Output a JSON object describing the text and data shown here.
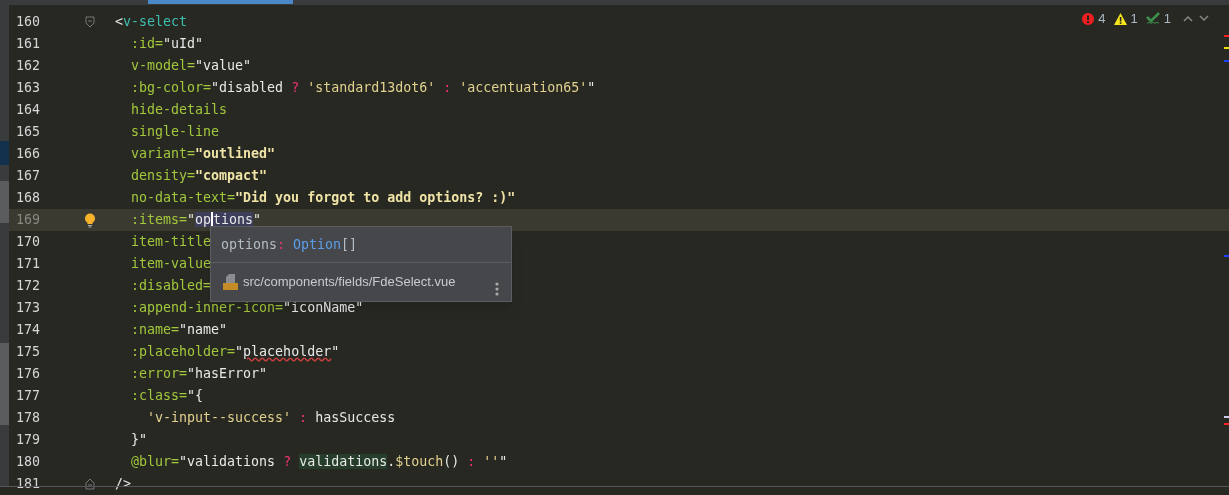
{
  "inspections": [
    {
      "kind": "error",
      "count": "4"
    },
    {
      "kind": "warning",
      "count": "1"
    },
    {
      "kind": "typo",
      "count": "1"
    }
  ],
  "lines": [
    {
      "number": "160",
      "current": false,
      "gutter_icon": {
        "kind": "fold-start"
      },
      "tokens": [
        {
          "kind": "punct",
          "text": "<"
        },
        {
          "kind": "tag",
          "text": "v-select"
        }
      ],
      "children": [
        {
          "number": "161",
          "current": false,
          "tokens": [
            {
              "kind": "attr",
              "text": ":id="
            },
            {
              "kind": "value",
              "text": "\"uId\""
            }
          ]
        },
        {
          "number": "162",
          "current": false,
          "tokens": [
            {
              "kind": "attr",
              "text": "v-model="
            },
            {
              "kind": "value",
              "text": "\"value\""
            }
          ]
        },
        {
          "number": "163",
          "current": false,
          "tokens": [
            {
              "kind": "attr",
              "text": ":bg-color="
            },
            {
              "kind": "value",
              "text": "\"disabled "
            },
            {
              "kind": "operator",
              "text": "?"
            },
            {
              "kind": "string",
              "text": " 'standard13dot6' "
            },
            {
              "kind": "operator",
              "text": ":"
            },
            {
              "kind": "string",
              "text": " 'accentuation65'"
            },
            {
              "kind": "value",
              "text": "\""
            }
          ]
        },
        {
          "number": "164",
          "current": false,
          "tokens": [
            {
              "kind": "attr",
              "text": "hide-details"
            }
          ]
        },
        {
          "number": "165",
          "current": false,
          "tokens": [
            {
              "kind": "attr",
              "text": "single-line"
            }
          ]
        },
        {
          "number": "166",
          "current": false,
          "tokens": [
            {
              "kind": "attr",
              "text": "variant="
            },
            {
              "kind": "bold",
              "text": "\"outlined\""
            }
          ]
        },
        {
          "number": "167",
          "current": false,
          "tokens": [
            {
              "kind": "attr",
              "text": "density="
            },
            {
              "kind": "bold",
              "text": "\"compact\""
            }
          ]
        },
        {
          "number": "168",
          "current": false,
          "tokens": [
            {
              "kind": "attr",
              "text": "no-data-text="
            },
            {
              "kind": "bold",
              "text": "\"Did you forgot to add options? :)\""
            }
          ]
        },
        {
          "number": "169",
          "current": true,
          "gutter_icon": {
            "kind": "bulb"
          },
          "tokens": [
            {
              "kind": "attr",
              "text": ":items="
            },
            {
              "kind": "value",
              "text": "\""
            },
            {
              "kind": "ref",
              "text": "op"
            },
            {
              "kind": "ref-caret",
              "text": "tions"
            },
            {
              "kind": "value",
              "text": "\""
            }
          ]
        },
        {
          "number": "170",
          "current": false,
          "tokens": [
            {
              "kind": "attr",
              "text": "item-title"
            }
          ]
        },
        {
          "number": "171",
          "current": false,
          "tokens": [
            {
              "kind": "attr",
              "text": "item-value"
            }
          ]
        },
        {
          "number": "172",
          "current": false,
          "tokens": [
            {
              "kind": "attr",
              "text": ":disabled="
            }
          ]
        },
        {
          "number": "173",
          "current": false,
          "tokens": [
            {
              "kind": "attr",
              "text": ":append-inner-icon="
            },
            {
              "kind": "value",
              "text": "\"iconName\""
            }
          ]
        },
        {
          "number": "174",
          "current": false,
          "tokens": [
            {
              "kind": "attr",
              "text": ":name="
            },
            {
              "kind": "value",
              "text": "\"name\""
            }
          ]
        },
        {
          "number": "175",
          "current": false,
          "tokens": [
            {
              "kind": "attr",
              "text": ":placeholder="
            },
            {
              "kind": "value",
              "text": "\""
            },
            {
              "kind": "typo",
              "text": "placeholder"
            },
            {
              "kind": "value",
              "text": "\""
            }
          ]
        },
        {
          "number": "176",
          "current": false,
          "tokens": [
            {
              "kind": "attr",
              "text": ":error="
            },
            {
              "kind": "value",
              "text": "\"hasError\""
            }
          ]
        },
        {
          "number": "177",
          "current": false,
          "tokens": [
            {
              "kind": "attr",
              "text": ":class="
            },
            {
              "kind": "value",
              "text": "\"{"
            }
          ],
          "children": [
            {
              "number": "178",
              "current": false,
              "tokens": [
                {
                  "kind": "string",
                  "text": "'v-input--success' "
                },
                {
                  "kind": "operator",
                  "text": ":"
                },
                {
                  "kind": "value",
                  "text": " hasSuccess"
                }
              ]
            }
          ]
        },
        {
          "number": "179",
          "current": false,
          "tokens": [
            {
              "kind": "value",
              "text": "}\""
            }
          ]
        },
        {
          "number": "180",
          "current": false,
          "tokens": [
            {
              "kind": "attr",
              "text": "@blur="
            },
            {
              "kind": "value",
              "text": "\"validations "
            },
            {
              "kind": "operator",
              "text": "? "
            },
            {
              "kind": "usage",
              "text": "validations"
            },
            {
              "kind": "value",
              "text": "."
            },
            {
              "kind": "string",
              "text": "$touch"
            },
            {
              "kind": "value",
              "text": "() "
            },
            {
              "kind": "operator",
              "text": ":"
            },
            {
              "kind": "string",
              "text": " ''"
            },
            {
              "kind": "value",
              "text": "\""
            }
          ]
        }
      ]
    },
    {
      "number": "181",
      "current": false,
      "gutter_icon": {
        "kind": "fold-end"
      },
      "tokens": [
        {
          "kind": "punct",
          "text": "/>"
        }
      ]
    }
  ],
  "popup": {
    "name": "options",
    "separator": ":",
    "type": "Option",
    "suffix": "[]",
    "file": "src/components/fields/FdeSelect.vue"
  },
  "stripe_marks": [
    {
      "color": "#ff2020"
    },
    {
      "color": "#f0e000"
    },
    {
      "color": "#2040ff"
    },
    {
      "color": "#2040ff"
    },
    {
      "color": "#ccccee"
    },
    {
      "color": "#ff2020"
    }
  ]
}
